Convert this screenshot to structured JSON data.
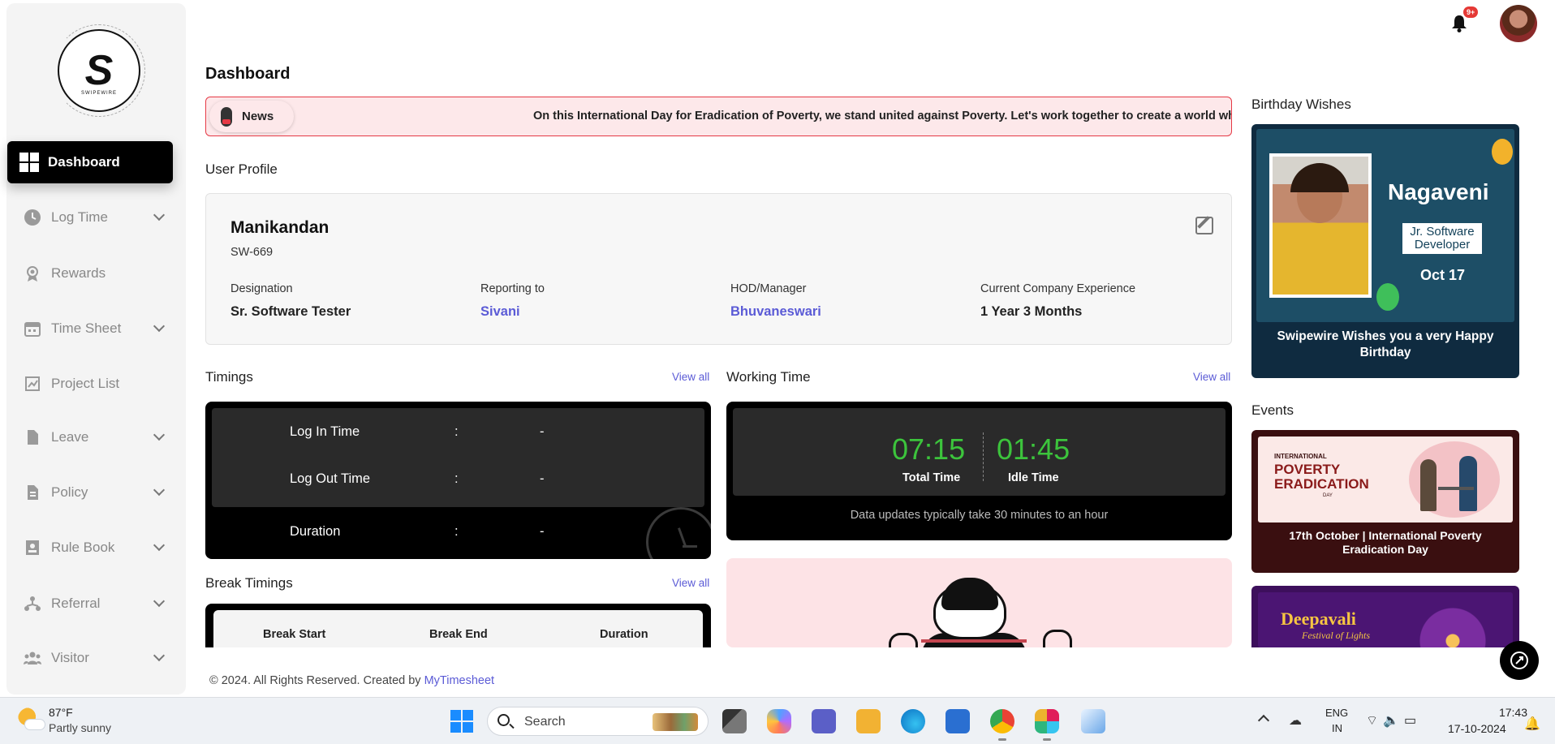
{
  "sidebar": {
    "brand": "SWIPEWIRE",
    "logo_letter": "S",
    "items": [
      {
        "label": "Dashboard",
        "icon": "dashboard-icon",
        "active": true
      },
      {
        "label": "Log Time",
        "icon": "clock-icon",
        "expandable": true
      },
      {
        "label": "Rewards",
        "icon": "award-icon"
      },
      {
        "label": "Time Sheet",
        "icon": "calendar-icon",
        "expandable": true
      },
      {
        "label": "Project List",
        "icon": "project-icon"
      },
      {
        "label": "Leave",
        "icon": "document-icon",
        "expandable": true
      },
      {
        "label": "Policy",
        "icon": "policy-icon",
        "expandable": true
      },
      {
        "label": "Rule Book",
        "icon": "rulebook-icon",
        "expandable": true
      },
      {
        "label": "Referral",
        "icon": "referral-icon",
        "expandable": true
      },
      {
        "label": "Visitor",
        "icon": "visitor-icon",
        "expandable": true
      }
    ]
  },
  "header": {
    "notification_badge": "9+"
  },
  "page_title": "Dashboard",
  "news": {
    "tag": "News",
    "text": "On this International Day for Eradication of Poverty, we stand united against Poverty. Let's work together to create a world wher"
  },
  "profile": {
    "section_title": "User Profile",
    "name": "Manikandan",
    "id": "SW-669",
    "fields": [
      {
        "label": "Designation",
        "value": "Sr. Software Tester",
        "link": false
      },
      {
        "label": "Reporting to",
        "value": "Sivani",
        "link": true
      },
      {
        "label": "HOD/Manager",
        "value": "Bhuvaneswari",
        "link": true
      },
      {
        "label": "Current Company Experience",
        "value": "1 Year 3 Months",
        "link": false
      }
    ]
  },
  "timings": {
    "title": "Timings",
    "view_all": "View all",
    "rows": [
      {
        "label": "Log In Time",
        "sep": ":",
        "value": "-"
      },
      {
        "label": "Log Out Time",
        "sep": ":",
        "value": "-"
      },
      {
        "label": "Duration",
        "sep": ":",
        "value": "-"
      }
    ]
  },
  "working_time": {
    "title": "Working Time",
    "view_all": "View all",
    "total_value": "07:15",
    "total_label": "Total Time",
    "idle_value": "01:45",
    "idle_label": "Idle Time",
    "note": "Data updates typically take 30 minutes to an hour"
  },
  "break_timings": {
    "title": "Break Timings",
    "view_all": "View all",
    "columns": [
      "Break Start",
      "Break End",
      "Duration"
    ]
  },
  "birthday": {
    "title": "Birthday Wishes",
    "name": "Nagaveni",
    "role": "Jr. Software Developer",
    "date": "Oct 17",
    "message": "Swipewire Wishes you a very Happy Birthday"
  },
  "events": {
    "title": "Events",
    "items": [
      {
        "art_small": "INTERNATIONAL",
        "art_big": "POVERTY ERADICATION",
        "art_day": "DAY",
        "caption": "17th October | International Poverty Eradication Day"
      },
      {
        "art_big": "Deepavali",
        "art_sub": "Festival of Lights"
      }
    ]
  },
  "footer": {
    "text": "© 2024. All Rights Reserved. Created by",
    "link": "MyTimesheet"
  },
  "taskbar": {
    "weather_temp": "87°F",
    "weather_desc": "Partly sunny",
    "search_placeholder": "Search",
    "lang_line1": "ENG",
    "lang_line2": "IN",
    "time": "17:43",
    "date": "17-10-2024",
    "apps": [
      "file-explorer-icon",
      "copilot-icon",
      "teams-icon",
      "folder-icon",
      "edge-icon",
      "store-icon",
      "chrome-icon",
      "slack-icon",
      "snipping-tool-icon"
    ]
  },
  "colors": {
    "accent_link": "#5b5bd6",
    "news_border": "#e53945",
    "timer_green": "#3cc43c",
    "active_nav": "#000000"
  }
}
